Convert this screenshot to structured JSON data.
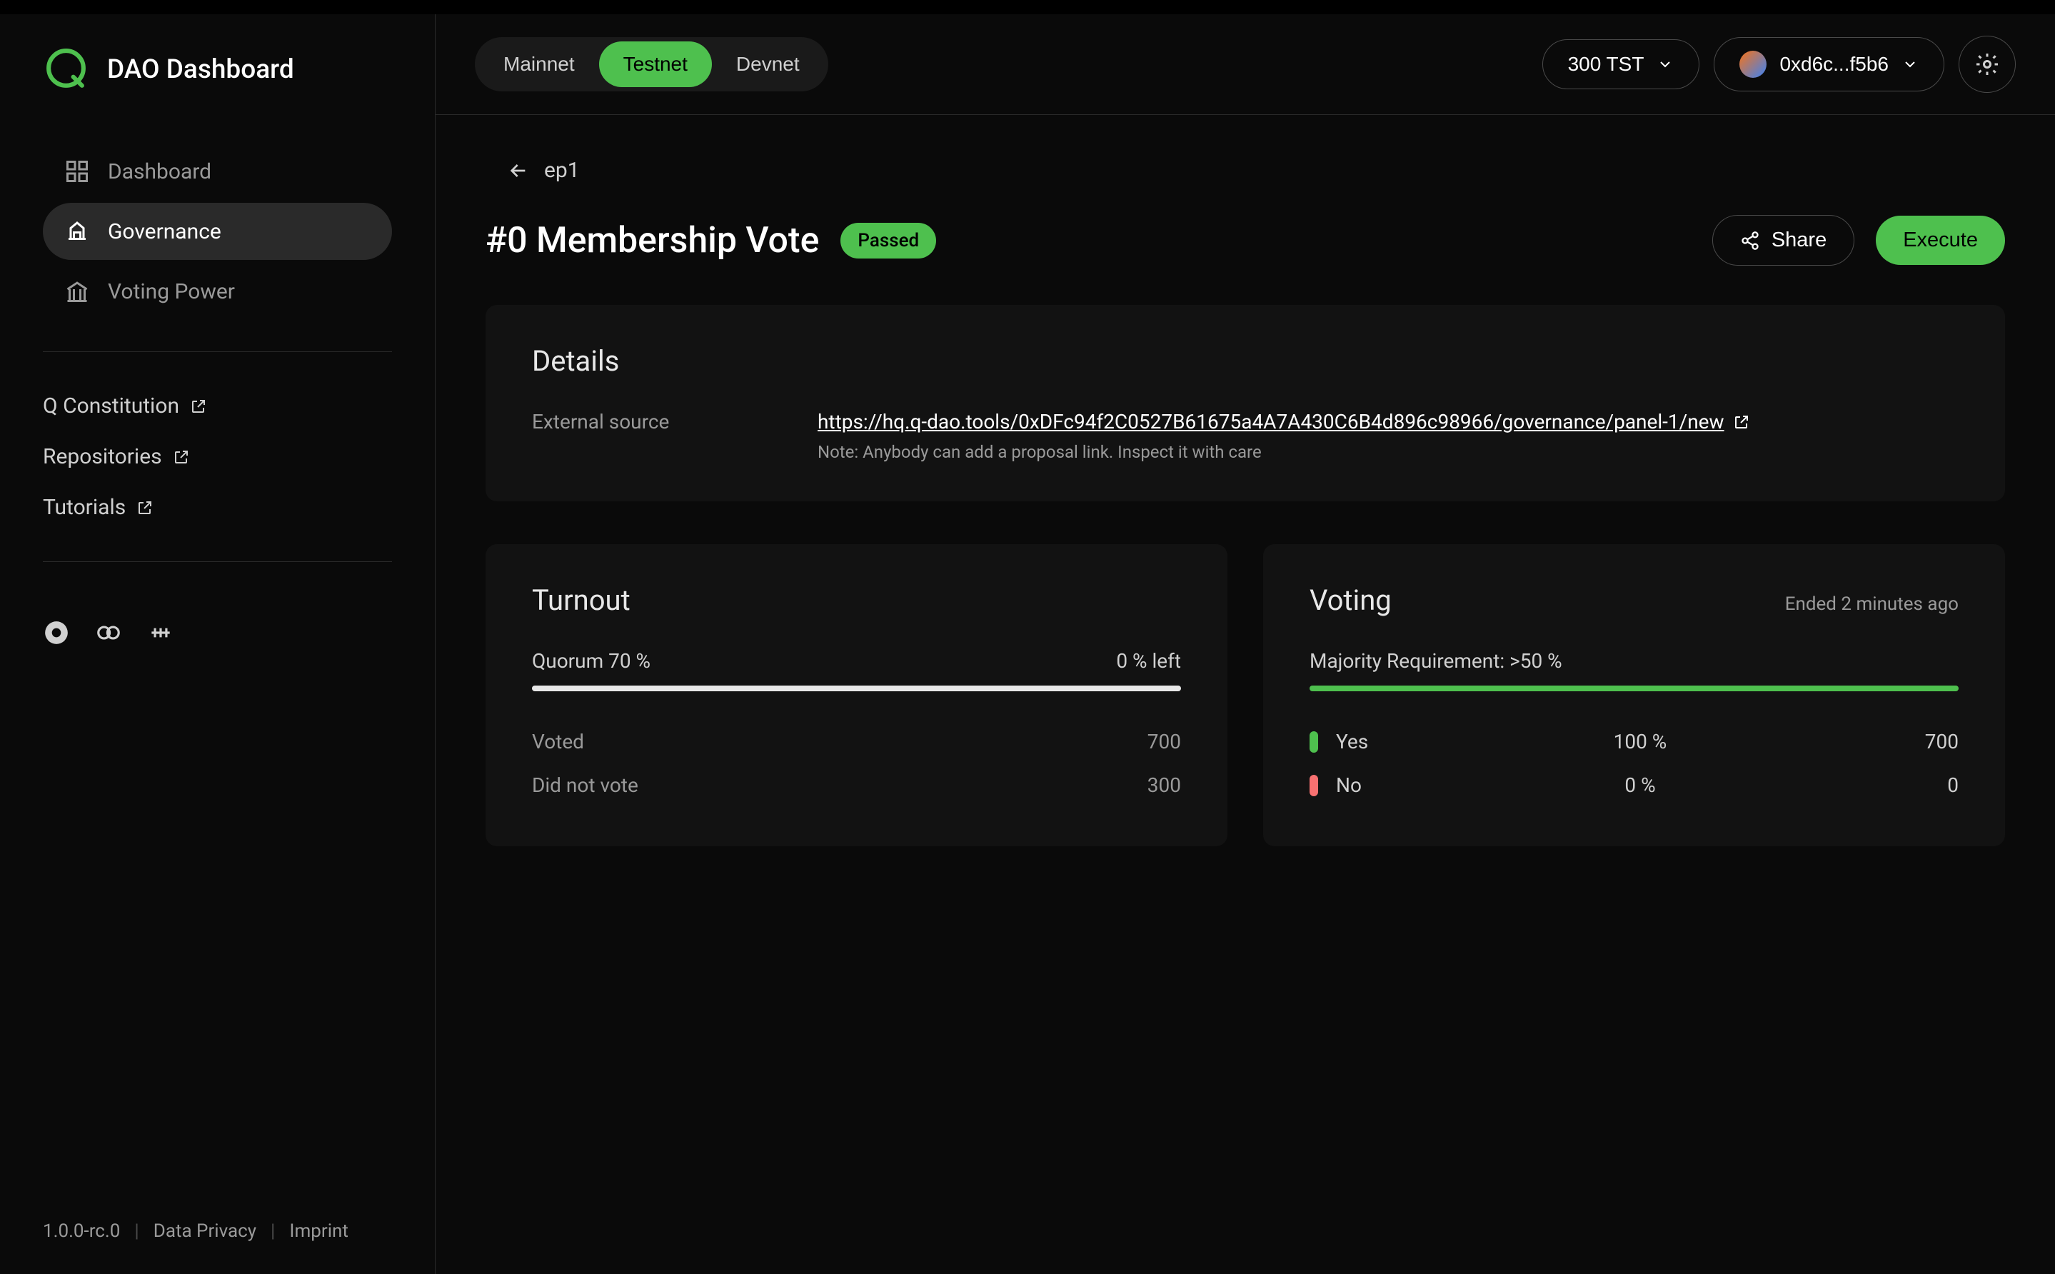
{
  "brand": {
    "name": "DAO Dashboard"
  },
  "sidebar": {
    "items": [
      {
        "label": "Dashboard"
      },
      {
        "label": "Governance"
      },
      {
        "label": "Voting Power"
      }
    ],
    "external": [
      {
        "label": "Q Constitution"
      },
      {
        "label": "Repositories"
      },
      {
        "label": "Tutorials"
      }
    ]
  },
  "footer": {
    "version": "1.0.0-rc.0",
    "privacy": "Data Privacy",
    "imprint": "Imprint"
  },
  "topbar": {
    "networks": [
      "Mainnet",
      "Testnet",
      "Devnet"
    ],
    "balance": "300 TST",
    "wallet": "0xd6c...f5b6"
  },
  "breadcrumb": {
    "label": "ep1"
  },
  "proposal": {
    "title": "#0 Membership Vote",
    "status": "Passed",
    "share": "Share",
    "execute": "Execute"
  },
  "details": {
    "title": "Details",
    "external_label": "External source",
    "external_url": "https://hq.q-dao.tools/0xDFc94f2C0527B61675a4A7A430C6B4d896c98966/governance/panel-1/new",
    "note": "Note: Anybody can add a proposal link. Inspect it with care"
  },
  "turnout": {
    "title": "Turnout",
    "quorum_label": "Quorum 70 %",
    "left_label": "0 % left",
    "progress_pct": 100,
    "voted_label": "Voted",
    "voted_value": "700",
    "notvoted_label": "Did not vote",
    "notvoted_value": "300"
  },
  "voting": {
    "title": "Voting",
    "ended": "Ended 2 minutes ago",
    "majority": "Majority Requirement: >50 %",
    "yes_pct": 100,
    "yes_label": "Yes",
    "yes_pct_text": "100 %",
    "yes_count": "700",
    "no_label": "No",
    "no_pct_text": "0 %",
    "no_count": "0"
  }
}
